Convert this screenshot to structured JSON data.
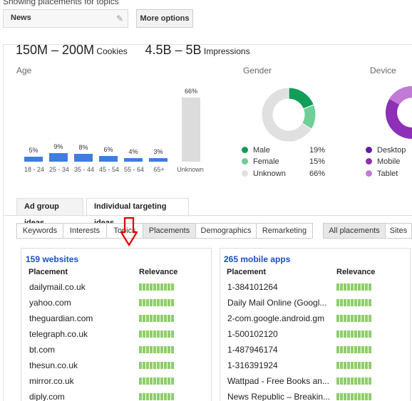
{
  "header": {
    "caption": "Showing placements for topics",
    "topic_value": "News",
    "more_options": "More options"
  },
  "stats": {
    "cookies_value": "150M – 200M",
    "cookies_label": "Cookies",
    "impressions_value": "4.5B – 5B",
    "impressions_label": "Impressions"
  },
  "sections": {
    "age": "Age",
    "gender": "Gender",
    "device": "Device"
  },
  "chart_data": [
    {
      "type": "bar",
      "title": "Age",
      "categories": [
        "18 - 24",
        "25 - 34",
        "35 - 44",
        "45 - 54",
        "55 - 64",
        "65+",
        "Unknown"
      ],
      "values": [
        5,
        9,
        8,
        6,
        4,
        3,
        66
      ],
      "labels": [
        "5%",
        "9%",
        "8%",
        "6%",
        "4%",
        "3%",
        "66%"
      ],
      "ylim": [
        0,
        66
      ]
    },
    {
      "type": "pie",
      "title": "Gender",
      "categories": [
        "Male",
        "Female",
        "Unknown"
      ],
      "values": [
        19,
        15,
        66
      ],
      "labels": [
        "19%",
        "15%",
        "66%"
      ],
      "colors": [
        "#0f9d58",
        "#6fcf97",
        "#e0e0e0"
      ]
    },
    {
      "type": "pie",
      "title": "Device",
      "categories": [
        "Desktop",
        "Mobile",
        "Tablet"
      ],
      "colors": [
        "#5e1f9e",
        "#8e2fb8",
        "#c27ad6"
      ]
    }
  ],
  "tabs": [
    "Ad group ideas",
    "Individual targeting ideas"
  ],
  "segments": [
    "Keywords",
    "Interests",
    "Topics",
    "Placements",
    "Demographics",
    "Remarketing",
    "All placements",
    "Sites"
  ],
  "websites": {
    "title": "159 websites",
    "col_placement": "Placement",
    "col_relevance": "Relevance",
    "rows": [
      "dailymail.co.uk",
      "yahoo.com",
      "theguardian.com",
      "telegraph.co.uk",
      "bt.com",
      "thesun.co.uk",
      "mirror.co.uk",
      "diply.com"
    ]
  },
  "apps": {
    "title": "265 mobile apps",
    "col_placement": "Placement",
    "col_relevance": "Relevance",
    "rows": [
      "1-384101264",
      "Daily Mail Online (Googl...",
      "2-com.google.android.gm",
      "1-500102120",
      "1-487946174",
      "1-316391924",
      "Wattpad - Free Books an...",
      "News Republic – Breakin..."
    ]
  },
  "colors": {
    "bar": "#3f7de0",
    "bar_unknown": "#dcdcdc",
    "link": "#1a4ec6",
    "relevance": "#8fce6a",
    "arrow": "#e00000"
  },
  "icons": {
    "edit": "pencil-icon",
    "annotation": "red-down-arrow-icon"
  }
}
